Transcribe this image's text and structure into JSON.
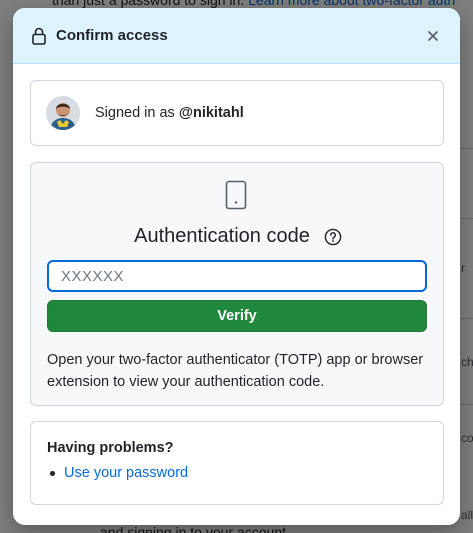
{
  "background": {
    "top_text": "than just a password to sign in.",
    "top_link": "Learn more about two-factor auth",
    "fragments": [
      "r",
      "che",
      "co",
      "all"
    ],
    "bottom_text": "and signing in to your account."
  },
  "dialog": {
    "title": "Confirm access",
    "close_icon": "close-icon",
    "lock_icon": "lock-icon"
  },
  "signed_in": {
    "prefix": "Signed in as",
    "username": "@nikitahl"
  },
  "auth": {
    "heading": "Authentication code",
    "input_placeholder": "XXXXXX",
    "input_value": "",
    "verify_label": "Verify",
    "help_text": "Open your two-factor authenticator (TOTP) app or browser extension to view your authentication code."
  },
  "problems": {
    "title": "Having problems?",
    "links": [
      {
        "label": "Use your password"
      }
    ]
  },
  "colors": {
    "accent": "#0969da",
    "success": "#1f883d",
    "header_bg": "#ddf4ff"
  }
}
